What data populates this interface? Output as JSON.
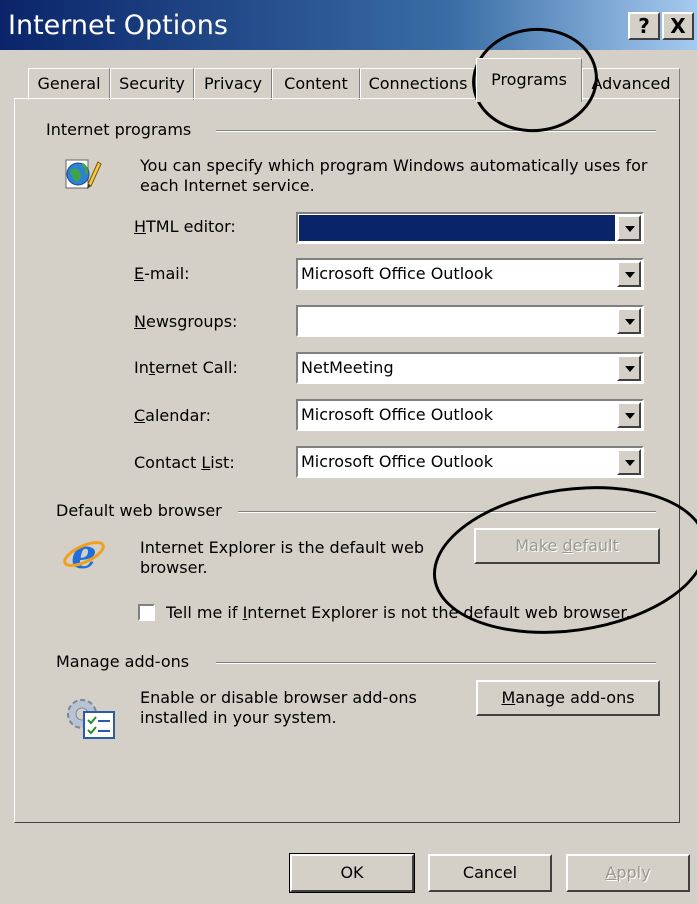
{
  "window": {
    "title": "Internet Options",
    "help_label": "?",
    "close_label": "X"
  },
  "tabs": [
    {
      "label": "General"
    },
    {
      "label": "Security"
    },
    {
      "label": "Privacy"
    },
    {
      "label": "Content"
    },
    {
      "label": "Connections"
    },
    {
      "label": "Programs",
      "active": true
    },
    {
      "label": "Advanced"
    }
  ],
  "internet_programs": {
    "group_label": "Internet programs",
    "description_line1": "You can specify which program Windows automatically uses for",
    "description_line2": "each Internet service.",
    "rows": [
      {
        "label": "HTML editor:",
        "accel": "H",
        "rest": "TML editor:",
        "value": ""
      },
      {
        "label": "E-mail:",
        "accel": "E",
        "rest": "-mail:",
        "value": "Microsoft Office Outlook"
      },
      {
        "label": "Newsgroups:",
        "accel": "N",
        "rest": "ewsgroups:",
        "value": ""
      },
      {
        "label": "Internet Call:",
        "pre": "In",
        "accel": "t",
        "rest": "ernet Call:",
        "value": "NetMeeting"
      },
      {
        "label": "Calendar:",
        "accel": "C",
        "rest": "alendar:",
        "value": "Microsoft Office Outlook"
      },
      {
        "label": "Contact List:",
        "pre": "Contact ",
        "accel": "L",
        "rest": "ist:",
        "value": "Microsoft Office Outlook"
      }
    ]
  },
  "default_browser": {
    "group_label": "Default web browser",
    "text_line1": "Internet Explorer is the default web",
    "text_line2": "browser.",
    "make_default_pre": "Make ",
    "make_default_accel": "d",
    "make_default_rest": "efault",
    "checkbox_pre": "Tell me if ",
    "checkbox_accel": "I",
    "checkbox_rest": "nternet Explorer is not the default web browser.",
    "checkbox_checked": false
  },
  "addons": {
    "group_label": "Manage add-ons",
    "text_line1": "Enable or disable browser add-ons",
    "text_line2": "installed in your system.",
    "button_accel": "M",
    "button_rest": "anage add-ons"
  },
  "footer": {
    "ok_label": "OK",
    "cancel_label": "Cancel",
    "apply_accel": "A",
    "apply_rest": "pply"
  },
  "colors": {
    "title_bar": "#0a246a",
    "dialog_face": "#d4d0c8",
    "highlight_selection": "#0a246a"
  }
}
